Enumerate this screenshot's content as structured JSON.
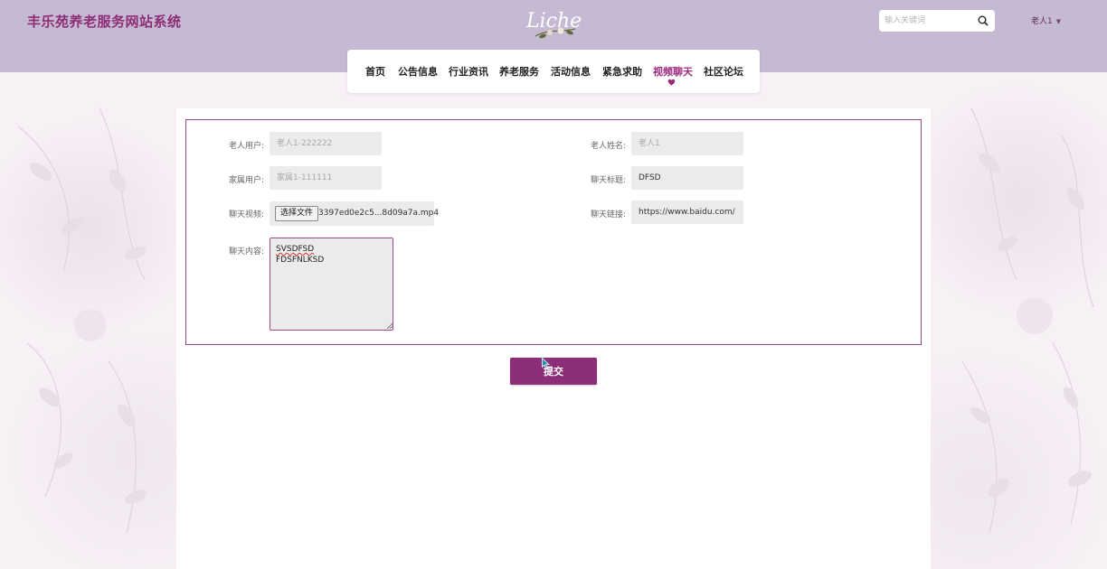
{
  "header": {
    "site_title": "丰乐苑养老服务网站系统",
    "logo_text": "Liche",
    "search": {
      "placeholder": "输入关键词",
      "value": ""
    },
    "user_menu_label": "老人1",
    "icons": {
      "search": "search-icon",
      "caret": "caret-down-icon"
    }
  },
  "nav": {
    "items": [
      {
        "label": "首页",
        "active": false
      },
      {
        "label": "公告信息",
        "active": false
      },
      {
        "label": "行业资讯",
        "active": false
      },
      {
        "label": "养老服务",
        "active": false
      },
      {
        "label": "活动信息",
        "active": false
      },
      {
        "label": "紧急求助",
        "active": false
      },
      {
        "label": "视频聊天",
        "active": true
      },
      {
        "label": "社区论坛",
        "active": false
      }
    ],
    "active_marker_icon": "heart-icon"
  },
  "form": {
    "elder_user": {
      "label": "老人用户:",
      "value": "老人1-222222"
    },
    "elder_name": {
      "label": "老人姓名:",
      "value": "老人1"
    },
    "family_user": {
      "label": "家属用户:",
      "value": "家属1-111111"
    },
    "chat_title": {
      "label": "聊天标题:",
      "value": "DFSD"
    },
    "chat_video": {
      "label": "聊天视频:",
      "button_label": "选择文件",
      "file_name": "3397ed0e2c5...8d09a7a.mp4"
    },
    "chat_link": {
      "label": "聊天链接:",
      "value": "https://www.baidu.com/"
    },
    "chat_content": {
      "label": "聊天内容:",
      "line1": "SVSDFSD",
      "line2": "FDSFNLKSD"
    },
    "submit_label": "提交"
  },
  "colors": {
    "header_bg": "#c6b9d4",
    "brand": "#8d2e74",
    "accent": "#9b2a7e",
    "button": "#8d2e7a"
  }
}
